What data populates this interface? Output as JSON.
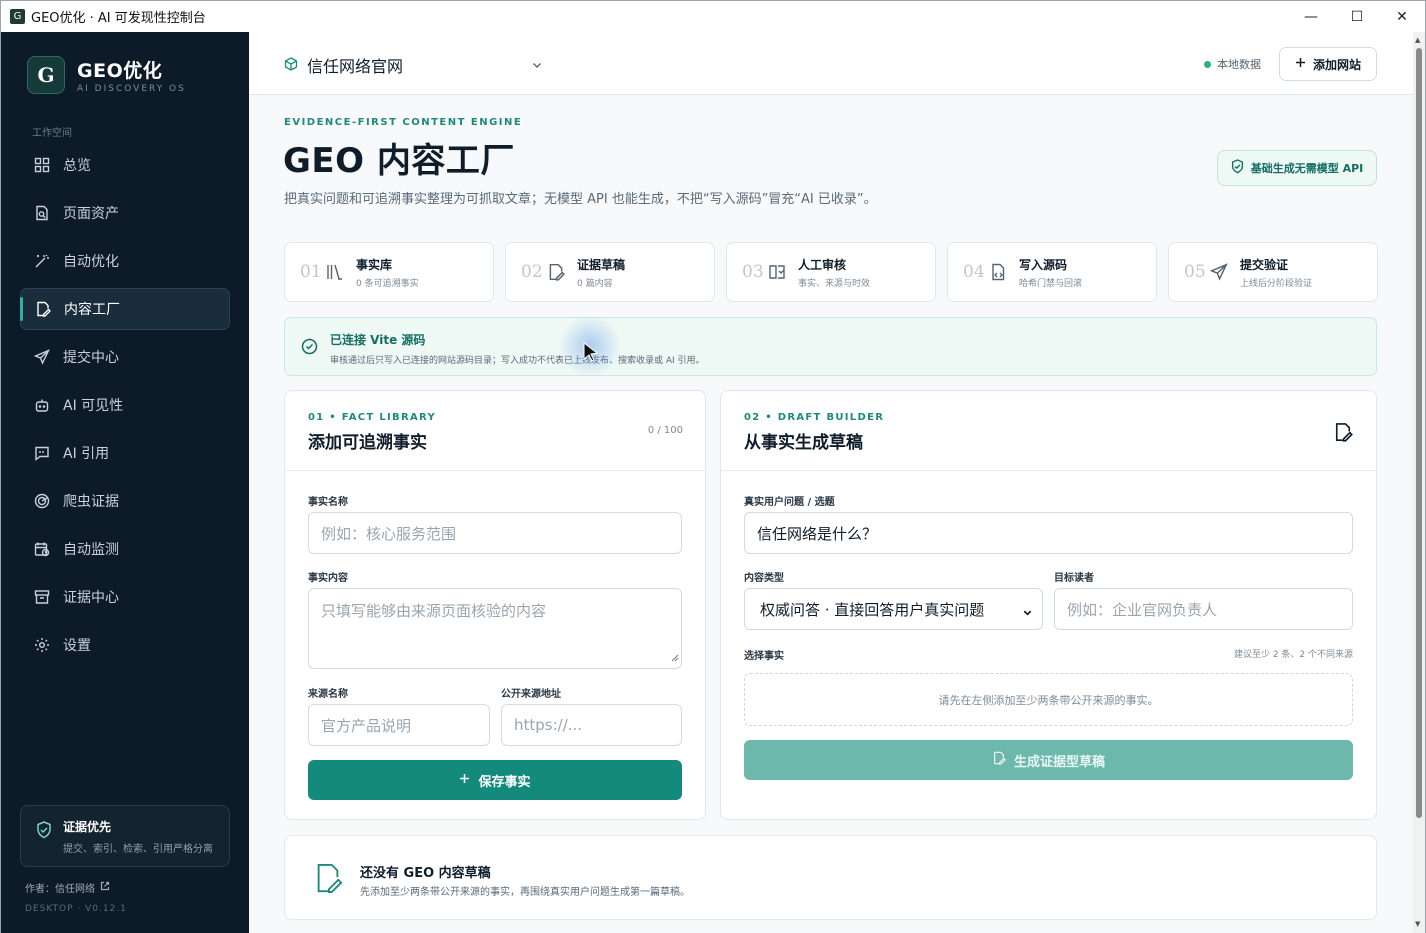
{
  "window": {
    "title": "GEO优化 · AI 可发现性控制台",
    "minimize": "—",
    "maximize": "☐",
    "close": "✕"
  },
  "sidebar": {
    "brand_name": "GEO优化",
    "brand_sub": "AI DISCOVERY OS",
    "logo_letter": "G",
    "workspace_label": "工作空间",
    "items": [
      {
        "label": "总览",
        "icon": "grid-icon"
      },
      {
        "label": "页面资产",
        "icon": "file-search-icon"
      },
      {
        "label": "自动优化",
        "icon": "magic-wand-icon"
      },
      {
        "label": "内容工厂",
        "icon": "file-edit-icon",
        "active": true
      },
      {
        "label": "提交中心",
        "icon": "send-icon"
      },
      {
        "label": "AI 可见性",
        "icon": "bot-icon"
      },
      {
        "label": "AI 引用",
        "icon": "message-quote-icon"
      },
      {
        "label": "爬虫证据",
        "icon": "radar-icon"
      },
      {
        "label": "自动监测",
        "icon": "calendar-clock-icon"
      },
      {
        "label": "证据中心",
        "icon": "archive-icon"
      },
      {
        "label": "设置",
        "icon": "gear-icon"
      }
    ],
    "evidence_title": "证据优先",
    "evidence_sub": "提交、索引、检索、引用严格分离",
    "author": "作者：信任网络",
    "version": "DESKTOP · V0.12.1"
  },
  "topbar": {
    "site_name": "信任网络官网",
    "local_data": "本地数据",
    "add_site": "添加网站"
  },
  "header": {
    "eyebrow": "EVIDENCE-FIRST CONTENT ENGINE",
    "title": "GEO 内容工厂",
    "desc": "把真实问题和可追溯事实整理为可抓取文章；无模型 API 也能生成，不把“写入源码”冒充“AI 已收录”。",
    "api_badge": "基础生成无需模型 API"
  },
  "steps": [
    {
      "num": "01",
      "title": "事实库",
      "sub": "0 条可追溯事实",
      "icon": "library-icon"
    },
    {
      "num": "02",
      "title": "证据草稿",
      "sub": "0 篇内容",
      "icon": "file-edit-icon"
    },
    {
      "num": "03",
      "title": "人工审核",
      "sub": "事实、来源与时效",
      "icon": "book-check-icon"
    },
    {
      "num": "04",
      "title": "写入源码",
      "sub": "哈希门禁与回滚",
      "icon": "file-code-icon"
    },
    {
      "num": "05",
      "title": "提交验证",
      "sub": "上线后分阶段验证",
      "icon": "send-icon"
    }
  ],
  "banner": {
    "title": "已连接 Vite 源码",
    "sub": "审核通过后只写入已连接的网站源码目录；写入成功不代表已上线发布、搜索收录或 AI 引用。"
  },
  "fact_panel": {
    "eyebrow": "01 • FACT LIBRARY",
    "title": "添加可追溯事实",
    "counter": "0 / 100",
    "name_label": "事实名称",
    "name_placeholder": "例如：核心服务范围",
    "content_label": "事实内容",
    "content_placeholder": "只填写能够由来源页面核验的内容",
    "source_label": "来源名称",
    "source_placeholder": "官方产品说明",
    "url_label": "公开来源地址",
    "url_placeholder": "https://...",
    "save_button": "保存事实"
  },
  "draft_panel": {
    "eyebrow": "02 • DRAFT BUILDER",
    "title": "从事实生成草稿",
    "question_label": "真实用户问题 / 选题",
    "question_value": "信任网络是什么？",
    "type_label": "内容类型",
    "type_value": "权威问答 · 直接回答用户真实问题",
    "reader_label": "目标读者",
    "reader_placeholder": "例如：企业官网负责人",
    "facts_label": "选择事实",
    "facts_hint": "建议至少 2 条、2 个不同来源",
    "facts_empty": "请先在左侧添加至少两条带公开来源的事实。",
    "generate_button": "生成证据型草稿"
  },
  "empty_state": {
    "title": "还没有 GEO 内容草稿",
    "sub": "先添加至少两条带公开来源的事实，再围绕真实用户问题生成第一篇草稿。"
  },
  "colors": {
    "accent": "#138a7c",
    "sidebar_bg": "#0d1a27",
    "badge_bg": "#eef8f5"
  }
}
